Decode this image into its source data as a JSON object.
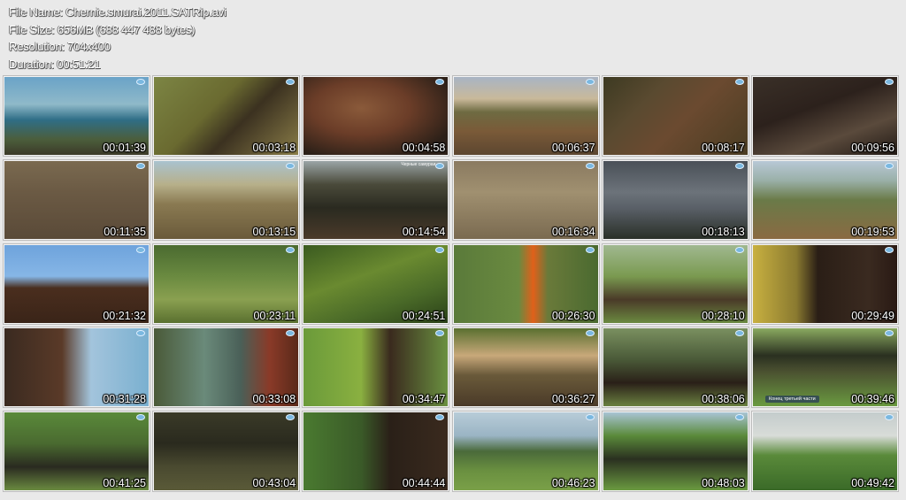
{
  "info": {
    "file_name": "File Name: Chernie.smurai.2011.SATRip.avi",
    "file_size": "File Size: 656MB (688 447 488 bytes)",
    "resolution": "Resolution: 704x400",
    "duration": "Duration: 00:51:21"
  },
  "thumbnails": [
    {
      "time": "00:01:39",
      "bg": "linear-gradient(180deg,#6aa3c8 0%,#8fb9c9 35%,#2f6e86 55%,#4b5e3c 80%,#3c3a28 100%)"
    },
    {
      "time": "00:03:18",
      "bg": "linear-gradient(135deg,#7c8544 0%,#6a6a30 40%,#3b3120 60%,#8a7d48 100%)"
    },
    {
      "time": "00:04:58",
      "bg": "radial-gradient(ellipse at 40% 40%,#8a5a3a 0%,#6b3d28 40%,#2c2018 80%),#ad9a86"
    },
    {
      "time": "00:06:37",
      "bg": "linear-gradient(180deg,#a8b4c4 0%,#c9b99a 28%,#6e6b42 45%,#7a5a38 70%,#5c4630 100%)"
    },
    {
      "time": "00:08:17",
      "bg": "linear-gradient(135deg,#3d3a22 0%,#5a4a30 30%,#6b4a30 55%,#4a3c22 100%)"
    },
    {
      "time": "00:09:56",
      "bg": "linear-gradient(160deg,#3a3028 0%,#2c211c 40%,#5a4a3c 70%,#221a15 100%)"
    },
    {
      "time": "00:11:35",
      "bg": "linear-gradient(180deg,#7a6a50 0%,#6b5a44 40%,#5a4a38 100%)"
    },
    {
      "time": "00:13:15",
      "bg": "linear-gradient(180deg,#a9c2cf 0%,#b7b08a 30%,#8a7a52 55%,#6a5a3a 100%)"
    },
    {
      "time": "00:14:54",
      "bg": "linear-gradient(180deg,#9aa4a6 0%,#4a4a3a 30%,#2a2a20 60%,#4a3a2a 100%)"
    },
    {
      "time": "00:16:34",
      "bg": "linear-gradient(180deg,#8a7a60 0%,#a09070 40%,#7a6a50 100%)"
    },
    {
      "time": "00:18:13",
      "bg": "linear-gradient(180deg,#4a5058 0%,#6c737a 40%,#5a6068 60%,#2a3028 100%)"
    },
    {
      "time": "00:19:53",
      "bg": "linear-gradient(180deg,#b8c8d6 0%,#9ab0a8 25%,#6a7a48 50%,#8a6a42 100%)"
    },
    {
      "time": "00:21:32",
      "bg": "linear-gradient(180deg,#6ea3dc 0%,#86b6e6 40%,#4a2e1e 55%,#3a2418 100%)"
    },
    {
      "time": "00:23:11",
      "bg": "linear-gradient(180deg,#4a6a30 0%,#6a8a40 40%,#8aa050 70%,#5a7030 100%)"
    },
    {
      "time": "00:24:51",
      "bg": "linear-gradient(160deg,#3a5a20 0%,#6a8a30 40%,#4a6a28 70%,#2a4018 100%)"
    },
    {
      "time": "00:26:30",
      "bg": "linear-gradient(90deg,#5a7a3a 0%,#6a8a40 45%,#e0601a 55%,#6a7a3a 65%,#4a6a30 100%)"
    },
    {
      "time": "00:28:10",
      "bg": "linear-gradient(180deg,#a0b890 0%,#7a9a50 40%,#4a3a28 70%,#6a8a40 100%)"
    },
    {
      "time": "00:29:49",
      "bg": "linear-gradient(90deg,#c8b040 0%,#8a7a30 30%,#2a1e16 45%,#3a2a20 80%,#2a1a14 100%)"
    },
    {
      "time": "00:31:28",
      "bg": "linear-gradient(90deg,#3a2a20 0%,#5a3a28 40%,#a3c4dc 60%,#7ab0d0 100%)"
    },
    {
      "time": "00:33:08",
      "bg": "linear-gradient(90deg,#4a5a38 0%,#6a8a7a 35%,#4a6058 60%,#8a3a28 80%,#5a2a1a 100%)"
    },
    {
      "time": "00:34:47",
      "bg": "linear-gradient(90deg,#6a9a3a 0%,#8ab040 40%,#3a2a1e 60%,#6a9040 100%)"
    },
    {
      "time": "00:36:27",
      "bg": "linear-gradient(180deg,#5a7030 0%,#c8a87a 35%,#6a5a3a 60%,#4a3a28 100%)"
    },
    {
      "time": "00:38:06",
      "bg": "linear-gradient(180deg,#7a9060 0%,#4a5a38 40%,#2a2018 70%,#6a8040 100%)"
    },
    {
      "time": "00:39:46",
      "bg": "linear-gradient(180deg,#8aaa60 0%,#2a3020 35%,#4a5030 55%,#6a9a40 100%)"
    },
    {
      "time": "00:41:25",
      "bg": "linear-gradient(180deg,#5a8a3a 0%,#4a6a30 40%,#2a2a20 70%,#6a8a40 100%)"
    },
    {
      "time": "00:43:04",
      "bg": "linear-gradient(180deg,#3a3a28 0%,#2a2a1e 40%,#4a4a30 70%,#5a5a38 100%)"
    },
    {
      "time": "00:44:44",
      "bg": "linear-gradient(90deg,#4a7a30 0%,#3a5a28 40%,#2a2018 60%,#3a2a1e 100%)"
    },
    {
      "time": "00:46:23",
      "bg": "linear-gradient(180deg,#b8ccd8 0%,#9ab4c4 30%,#4a6a3a 50%,#6a9040 75%,#7aa048 100%)"
    },
    {
      "time": "00:48:03",
      "bg": "linear-gradient(180deg,#a8c4d4 0%,#5a8a3a 30%,#2a3020 60%,#6a9a40 100%)"
    },
    {
      "time": "00:49:42",
      "bg": "linear-gradient(180deg,#c4cccc 0%,#d8dcd8 30%,#5a8a3a 55%,#3a6a28 100%)"
    }
  ],
  "overlay": {
    "cell_15_caption": "Черные самураи",
    "cell_24_badge": "Конец третьей части"
  }
}
